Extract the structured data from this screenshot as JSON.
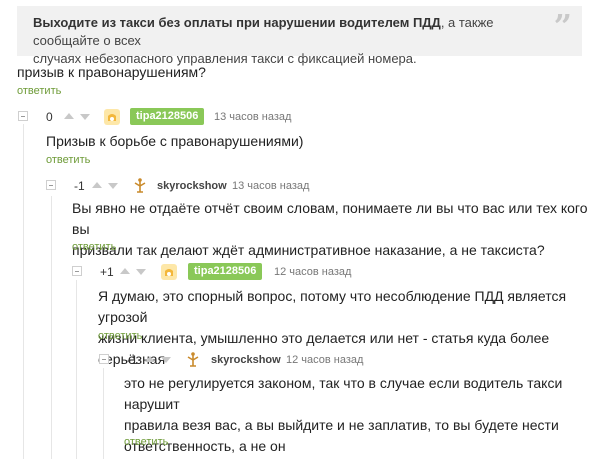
{
  "quote": {
    "bold": "Выходите из такси без оплаты при нарушении водителем ПДД",
    "rest": ", а также сообщайте о всех",
    "line2": "случаях небезопасного управления такси с фиксацией номера.",
    "icon": "quote-mark-icon"
  },
  "parent": {
    "line": "призыв к правонарушениям?",
    "reply": "ответить"
  },
  "comments": [
    {
      "rating": "0",
      "author": "tipa2128506",
      "time": "13 часов назад",
      "lines": [
        "Призыв к борьбе с правонарушениями)"
      ],
      "reply": "ответить"
    },
    {
      "rating": "-1",
      "author": "skyrockshow",
      "time": "13 часов назад",
      "lines": [
        "Вы явно не отдаёте отчёт своим словам, понимаете ли вы что вас или тех кого вы",
        "призвали так делают ждёт административное наказание, а не таксиста?"
      ],
      "reply": "ответить"
    },
    {
      "rating": "+1",
      "author": "tipa2128506",
      "time": "12 часов назад",
      "lines": [
        "Я думаю, это спорный вопрос, потому что несоблюдение ПДД является угрозой",
        "жизни клиента, умышленно это делается или нет - статья куда более серьёзная"
      ],
      "reply": "ответить"
    },
    {
      "rating": "-1",
      "author": "skyrockshow",
      "time": "12 часов назад",
      "lines": [
        "это не регулируется законом, так что в случае если водитель такси нарушит",
        "правила везя вас, а вы выйдите и не заплатив, то вы будете нести",
        "ответственность, а не он"
      ],
      "reply": "ответить"
    }
  ],
  "colors": {
    "reply": "#6e9b38",
    "badge": "#8ac858",
    "quote_bg": "#f1f1f1"
  }
}
